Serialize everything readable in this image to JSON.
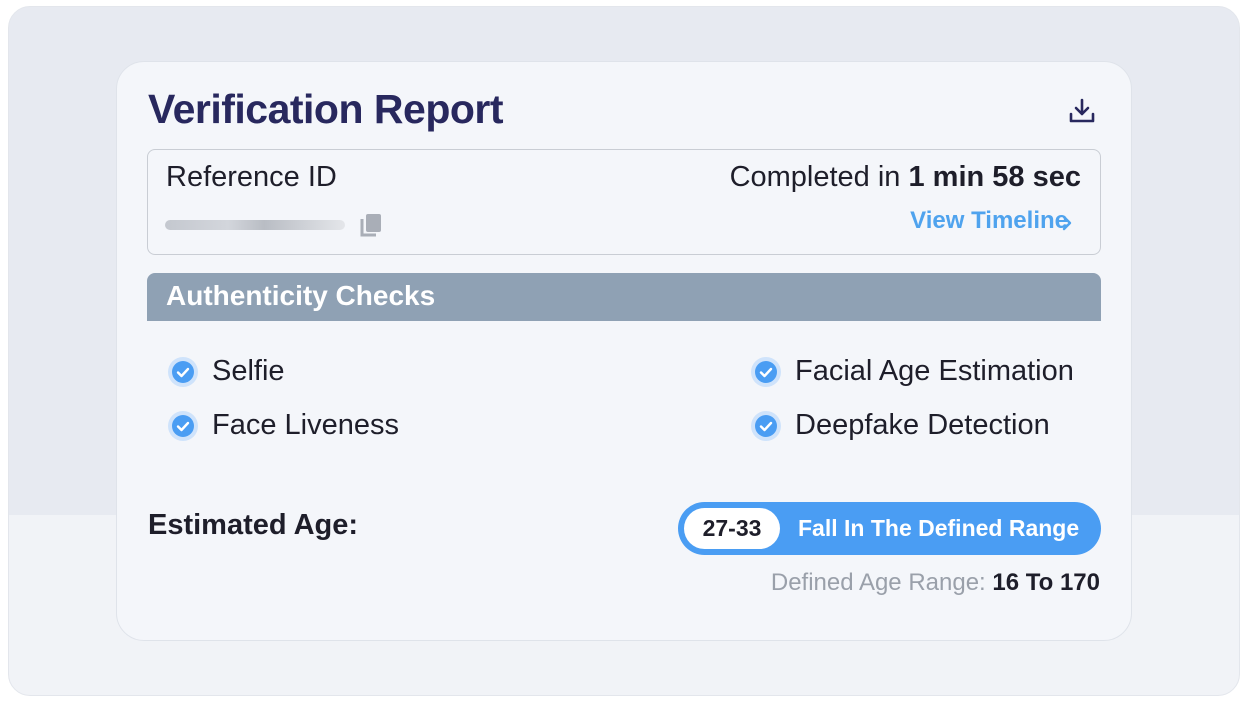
{
  "report": {
    "title": "Verification Report",
    "download_icon": "download-icon"
  },
  "reference": {
    "label": "Reference ID",
    "copy_icon": "copy-icon",
    "completed_prefix": "Completed in",
    "completed_time": "1 min 58 sec",
    "view_timeline": "View Timeline",
    "chevron_icon": "chevron-right-icon"
  },
  "authenticity": {
    "title": "Authenticity Checks",
    "checks": [
      {
        "label": "Selfie",
        "icon": "check-circle-icon"
      },
      {
        "label": "Face Liveness",
        "icon": "check-circle-icon"
      },
      {
        "label": "Facial Age Estimation",
        "icon": "check-circle-icon"
      },
      {
        "label": "Deepfake Detection",
        "icon": "check-circle-icon"
      }
    ]
  },
  "age": {
    "label": "Estimated Age:",
    "value": "27-33",
    "status": "Fall In The Defined Range",
    "range_label": "Defined Age Range:",
    "range_value": "16 To 170"
  },
  "colors": {
    "title": "#28285e",
    "accent_blue": "#4a9df3",
    "link_blue": "#4fa3ee",
    "section_header": "#8fa1b4"
  }
}
